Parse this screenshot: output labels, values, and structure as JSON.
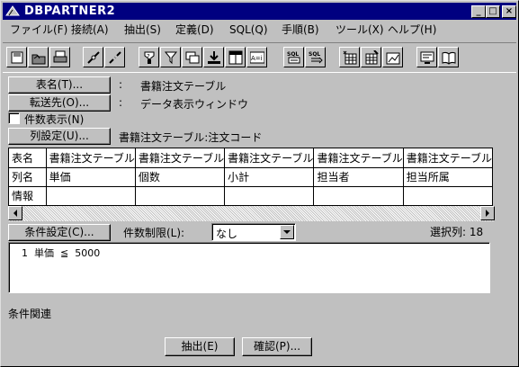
{
  "window": {
    "title": "DBPARTNER2",
    "controls": {
      "minimize": "_",
      "maximize": "□",
      "close": "×"
    }
  },
  "menu": [
    {
      "label": "ファイル(F)"
    },
    {
      "label": "接続(A)"
    },
    {
      "label": "抽出(S)"
    },
    {
      "label": "定義(D)"
    },
    {
      "label": "SQL(Q)"
    },
    {
      "label": "手順(B)"
    },
    {
      "label": "ツール(X)"
    },
    {
      "label": "ヘルプ(H)"
    }
  ],
  "toolbar": {
    "sql_label": "SQL",
    "asa_label": "A=i"
  },
  "fields": {
    "table_name_button": "表名(T)...",
    "table_name_value": "書籍注文テーブル",
    "destination_button": "転送先(O)...",
    "destination_value": "データ表示ウィンドウ",
    "count_display_label": "件数表示(N)",
    "count_display_checked": false,
    "column_setting_button": "列設定(U)...",
    "column_setting_value": "書籍注文テーブル:注文コード",
    "colon": ":"
  },
  "grid": {
    "row_headers": [
      "表名",
      "列名",
      "情報"
    ],
    "columns": [
      {
        "table": "書籍注文テーブル",
        "column": "単価",
        "info": ""
      },
      {
        "table": "書籍注文テーブル",
        "column": "個数",
        "info": ""
      },
      {
        "table": "書籍注文テーブル",
        "column": "小計",
        "info": ""
      },
      {
        "table": "書籍注文テーブル",
        "column": "担当者",
        "info": ""
      },
      {
        "table": "書籍注文テーブル",
        "column": "担当所属",
        "info": ""
      }
    ]
  },
  "conditions": {
    "button": "条件設定(C)...",
    "limit_label": "件数制限(L):",
    "limit_value": "なし",
    "selected_columns": "選択列: 18",
    "lines": [
      "1  単価  ≦  5000"
    ]
  },
  "condition_relation_label": "条件関連",
  "actions": {
    "extract": "抽出(E)",
    "confirm": "確認(P)..."
  }
}
